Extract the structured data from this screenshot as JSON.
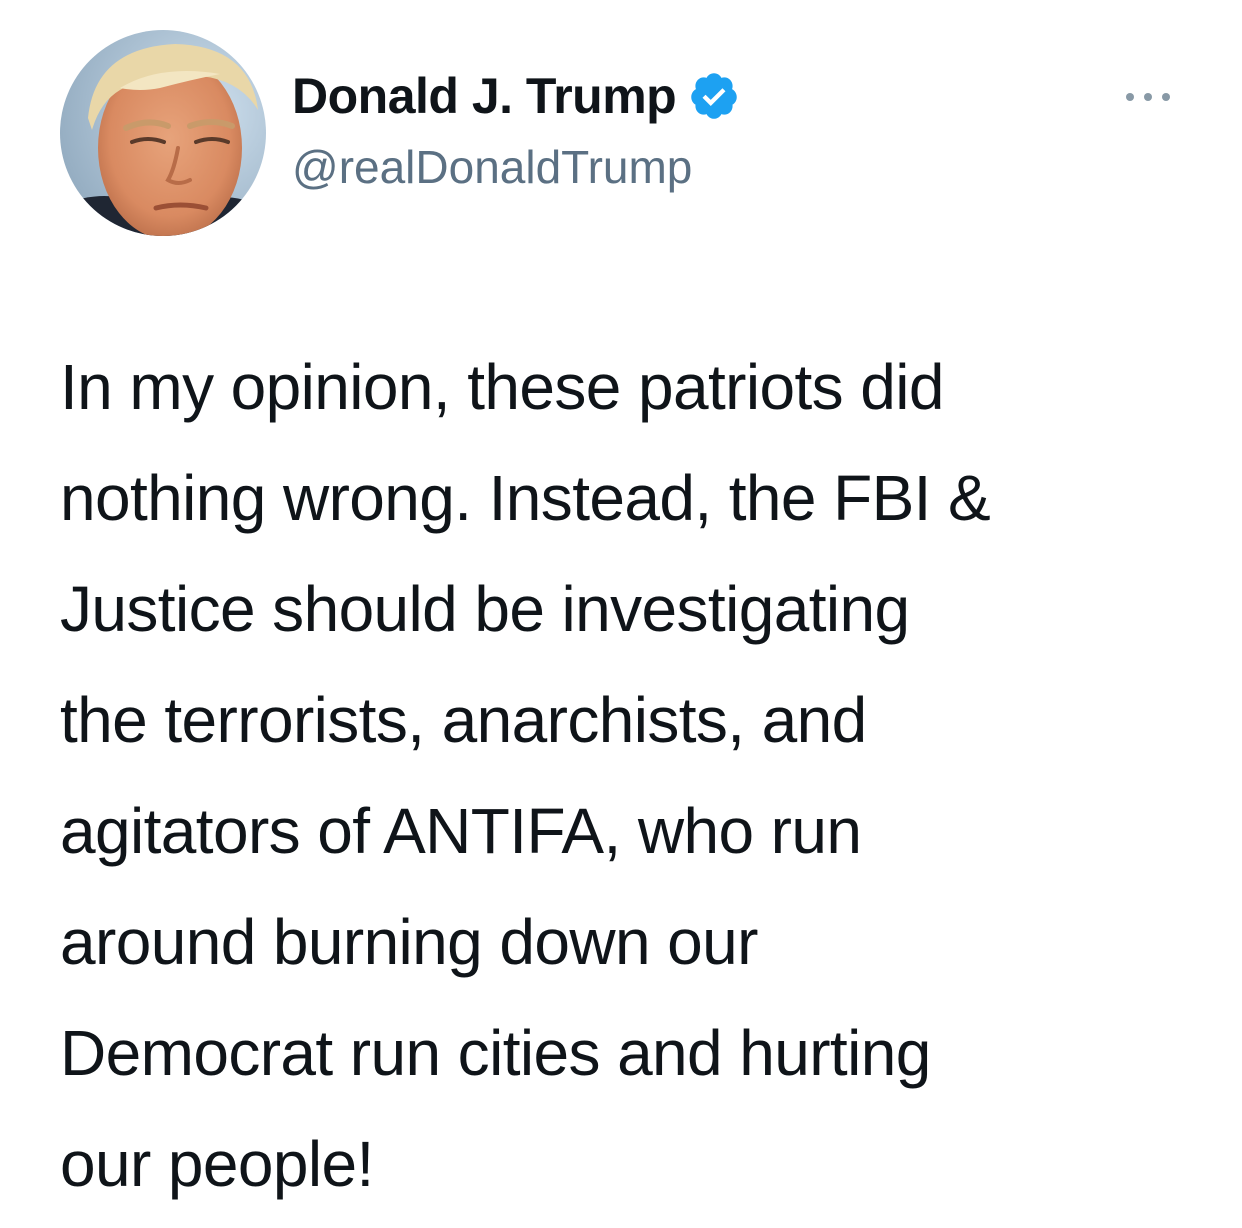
{
  "author": {
    "display_name": "Donald J. Trump",
    "handle": "@realDonaldTrump",
    "verified": true,
    "avatar_icon": "profile-photo-avatar",
    "verified_icon": "verified-badge-icon"
  },
  "tweet": {
    "lines": [
      "In my opinion, these patriots did",
      "nothing wrong. Instead, the FBI &",
      "Justice should be investigating",
      "the terrorists, anarchists, and",
      "agitators of ANTIFA, who run",
      "around burning down our",
      "Democrat run cities and hurting",
      "our people!"
    ]
  },
  "menu": {
    "icon": "more-options-icon"
  },
  "colors": {
    "verified_blue": "#1da1f2",
    "handle_gray": "#5b7083",
    "text": "#0f1419",
    "background": "#ffffff"
  }
}
